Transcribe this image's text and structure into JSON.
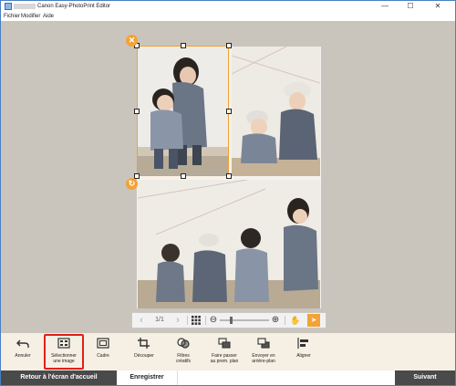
{
  "window": {
    "title": "Canon Easy-PhotoPrint Editor",
    "minimize": "—",
    "maximize": "☐",
    "close": "✕"
  },
  "menu": [
    "Fichier",
    "Modifier",
    "Aide"
  ],
  "selection": {
    "delete_glyph": "✕",
    "rotate_glyph": "↻"
  },
  "nav_toolbar": {
    "prev": "‹",
    "page_indicator": "1/1",
    "next": "›",
    "zoom_out": "⊖",
    "zoom_in": "⊕",
    "hand": "✋",
    "pointer": "➤",
    "zoom_level": 0.22
  },
  "tools": [
    {
      "label": "Annuler",
      "icon": "undo-icon"
    },
    {
      "label": "Sélectionner\nune image",
      "icon": "select-image-icon"
    },
    {
      "label": "Cadre",
      "icon": "frame-icon"
    },
    {
      "label": "Découper",
      "icon": "crop-icon"
    },
    {
      "label": "Filtres\ncréatifs",
      "icon": "creative-filters-icon"
    },
    {
      "label": "Faire passer\nau prem. plan",
      "icon": "bring-to-front-icon"
    },
    {
      "label": "Envoyer en\narrière-plan",
      "icon": "send-to-back-icon"
    },
    {
      "label": "Aligner",
      "icon": "align-icon"
    }
  ],
  "footer": {
    "back": "Retour à l'écran d'accueil",
    "save": "Enregistrer",
    "next": "Suivant"
  },
  "colors": {
    "accent": "#f3a236",
    "highlight": "#e0201a",
    "canvas": "#c9c5bd",
    "toolbar": "#f5efe4",
    "footer_dark": "#4a4a4a"
  }
}
